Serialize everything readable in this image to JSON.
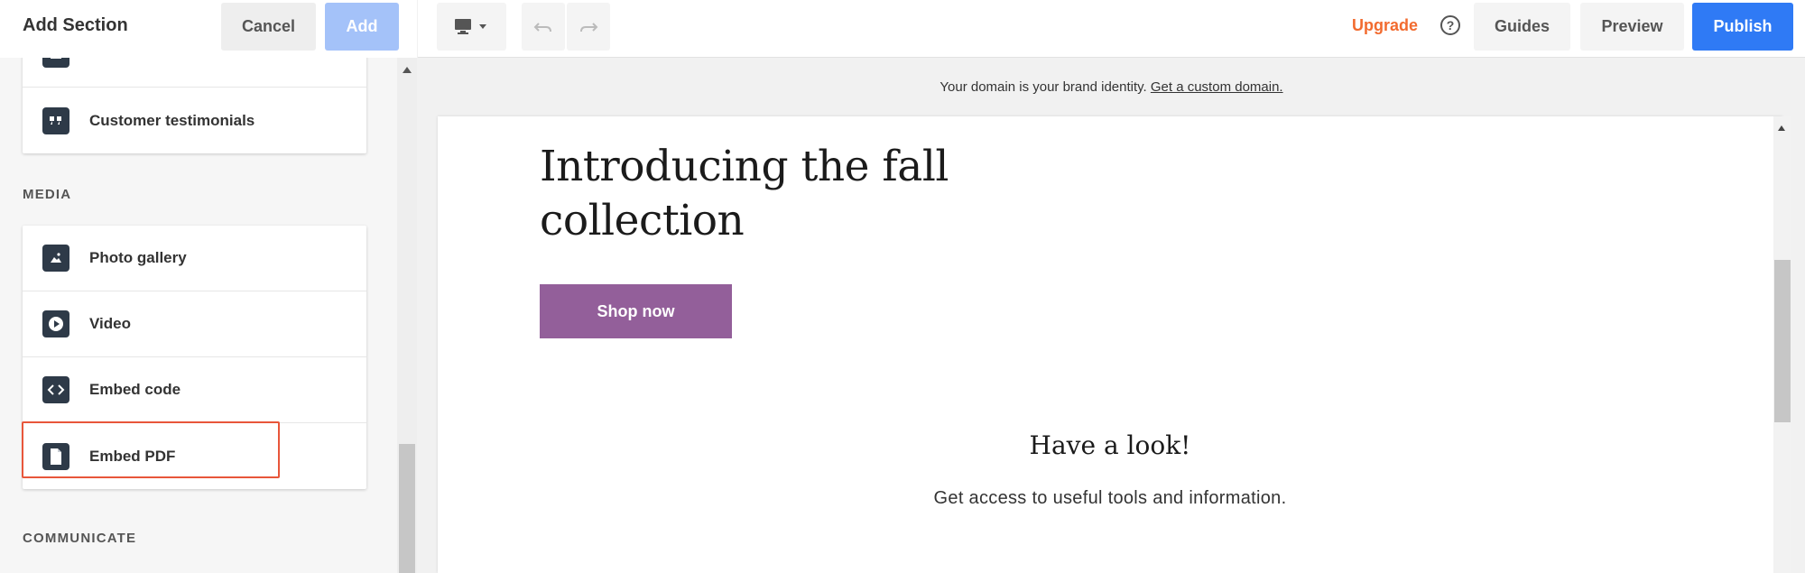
{
  "left_panel": {
    "title": "Add Section",
    "cancel_label": "Cancel",
    "add_label": "Add",
    "top_items": [
      {
        "label": "",
        "icon": "layout-icon"
      },
      {
        "label": "Customer testimonials",
        "icon": "quote-icon"
      }
    ],
    "media_heading": "MEDIA",
    "media_items": [
      {
        "label": "Photo gallery",
        "icon": "image-icon"
      },
      {
        "label": "Video",
        "icon": "play-icon"
      },
      {
        "label": "Embed code",
        "icon": "code-icon"
      },
      {
        "label": "Embed PDF",
        "icon": "document-icon"
      }
    ],
    "highlighted_item": "Embed code",
    "highlight_color": "#e8563a",
    "communicate_heading": "COMMUNICATE"
  },
  "toolbar": {
    "device_icon": "desktop-icon",
    "upgrade_label": "Upgrade",
    "help_symbol": "?",
    "guides_label": "Guides",
    "preview_label": "Preview",
    "publish_label": "Publish",
    "upgrade_color": "#f26b2f",
    "publish_color": "#2f7af5"
  },
  "domain_bar": {
    "text": "Your domain is your brand identity. ",
    "link_text": "Get a custom domain."
  },
  "canvas": {
    "hero_title": "Introducing the fall collection",
    "shop_button": "Shop now",
    "shop_button_color": "#935f9a",
    "look_title": "Have a look!",
    "look_subtitle": "Get access to useful tools and information."
  }
}
